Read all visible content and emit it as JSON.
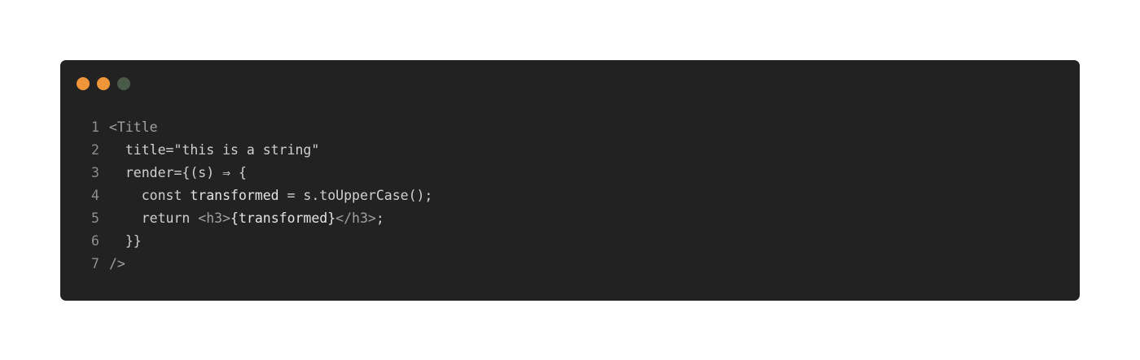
{
  "window": {
    "background": "#222222",
    "dots": [
      {
        "name": "close-dot",
        "color": "#f0963a"
      },
      {
        "name": "minimize-dot",
        "color": "#f0963a"
      },
      {
        "name": "maximize-dot",
        "color": "#4a5a48"
      }
    ]
  },
  "colors": {
    "line_number": "#8f8f8f",
    "tag": "#a0a0a0",
    "attr": "#cfcfcf",
    "text": "#e4e4e4"
  },
  "code": {
    "lines": [
      {
        "number": "1",
        "tokens": [
          {
            "text": "<Title",
            "color": "#a0a0a0"
          }
        ]
      },
      {
        "number": "2",
        "tokens": [
          {
            "text": "  title=\"this is a string\"",
            "color": "#cfcfcf"
          }
        ]
      },
      {
        "number": "3",
        "tokens": [
          {
            "text": "  render={(s) ⇒ {",
            "color": "#cfcfcf"
          }
        ]
      },
      {
        "number": "4",
        "tokens": [
          {
            "text": "    const ",
            "color": "#cfcfcf"
          },
          {
            "text": "transformed",
            "color": "#e4e4e4"
          },
          {
            "text": " = s.toUpperCase();",
            "color": "#cfcfcf"
          }
        ]
      },
      {
        "number": "5",
        "tokens": [
          {
            "text": "    return ",
            "color": "#cfcfcf"
          },
          {
            "text": "<h3>",
            "color": "#a0a0a0"
          },
          {
            "text": "{transformed}",
            "color": "#e4e4e4"
          },
          {
            "text": "</h3>",
            "color": "#a0a0a0"
          },
          {
            "text": ";",
            "color": "#cfcfcf"
          }
        ]
      },
      {
        "number": "6",
        "tokens": [
          {
            "text": "  }}",
            "color": "#cfcfcf"
          }
        ]
      },
      {
        "number": "7",
        "tokens": [
          {
            "text": "/>",
            "color": "#a0a0a0"
          }
        ]
      }
    ]
  }
}
